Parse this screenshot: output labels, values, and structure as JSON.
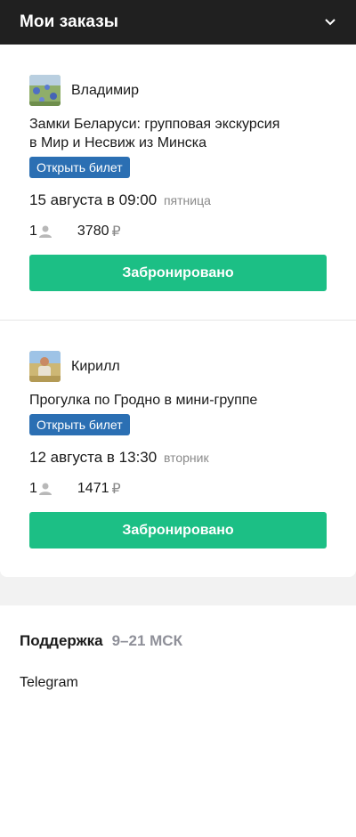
{
  "header": {
    "title": "Мои заказы",
    "toggle_icon": "chevron-down-icon"
  },
  "orders": [
    {
      "guide_name": "Владимир",
      "avatar_icon": "guide-avatar-image",
      "title_line1": "Замки Беларуси: групповая экскурсия",
      "title_line2": "в Мир и Несвиж из Минска",
      "ticket_label": "Открыть билет",
      "date": "15 августа в 09:00",
      "weekday": "пятница",
      "persons": "1",
      "price": "3780",
      "currency": "₽",
      "status_label": "Забронировано"
    },
    {
      "guide_name": "Кирилл",
      "avatar_icon": "guide-avatar-image",
      "title_line1": "Прогулка по Гродно в мини-группе",
      "ticket_label": "Открыть билет",
      "date": "12 августа в 13:30",
      "weekday": "вторник",
      "persons": "1",
      "price": "1471",
      "currency": "₽",
      "status_label": "Забронировано"
    }
  ],
  "support": {
    "title": "Поддержка",
    "hours": "9–21 МСК",
    "link": "Telegram"
  },
  "colors": {
    "header_bg": "#202020",
    "ticket_blue": "#2b6fb3",
    "booked_green": "#1cbf85",
    "muted": "#8a8a8a"
  }
}
